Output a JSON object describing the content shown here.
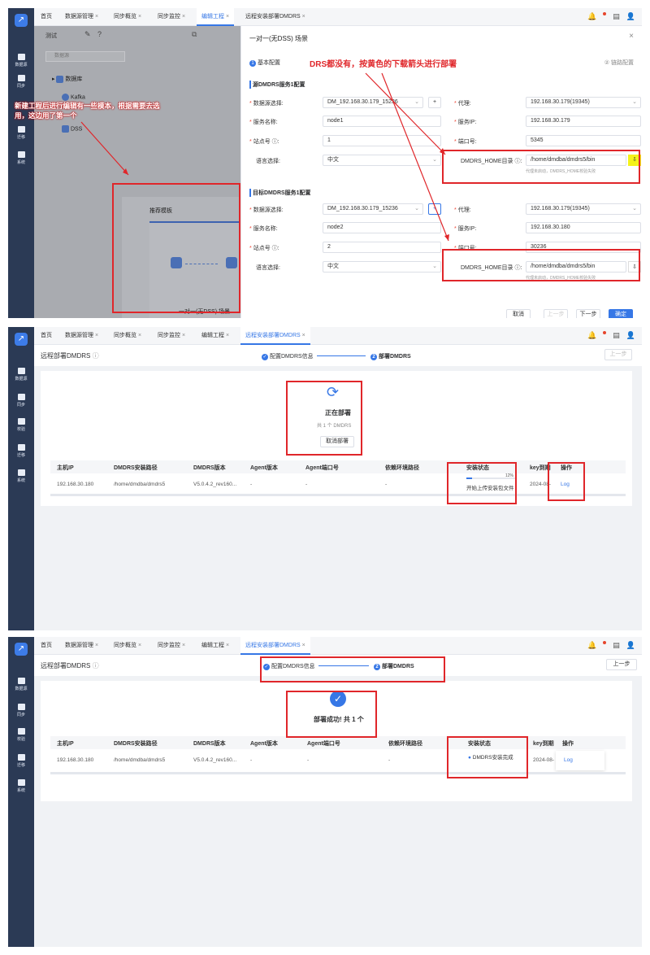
{
  "panel1": {
    "tabs": [
      "首页",
      "数据源管理",
      "同步概览",
      "同步监控",
      "编辑工程",
      "远程安装部署DMDRS"
    ],
    "nav": [
      "数据源",
      "同步",
      "迁移",
      "系统"
    ],
    "left": {
      "tool": "测试",
      "search_placeholder": "数据源",
      "tree": [
        "数据库",
        "Kafka",
        "DSS"
      ]
    },
    "tmpl_title": "推荐模板",
    "tmpl_name": "一对一(无DSS) 场景",
    "dialog": {
      "title": "一对一(无DSS) 场景",
      "step1": "基本配置",
      "step2": "链路配置",
      "src_title": "源DMDRS服务1配置",
      "dst_title": "目标DMDRS服务1配置",
      "lbl_ds": "数据源选择:",
      "lbl_svc": "服务名称:",
      "lbl_site": "站点号 ⓘ:",
      "lbl_lang": "语言选择:",
      "lbl_proxy": "代理:",
      "lbl_ip": "服务IP:",
      "lbl_port": "端口号:",
      "lbl_home": "DMDRS_HOME目录 ⓘ:",
      "src": {
        "ds": "DM_192.168.30.179_15236",
        "svc": "node1",
        "site": "1",
        "lang": "中文",
        "proxy": "192.168.30.179(19345)",
        "ip": "192.168.30.179",
        "port": "5345",
        "home": "/home/dmdba/dmdrs5/bin",
        "hint": "代理未启动，DMDRS_HOME校验失败"
      },
      "dst": {
        "ds": "DM_192.168.30.179_15236",
        "svc": "node2",
        "site": "2",
        "lang": "中文",
        "proxy": "192.168.30.179(19345)",
        "ip": "192.168.30.180",
        "port": "30236",
        "home": "/home/dmdba/dmdrs5/bin",
        "hint": "代理未启动，DMDRS_HOME校验失败"
      },
      "btns": [
        "取消",
        "上一步",
        "下一步",
        "确定"
      ]
    },
    "ann_left": "新建工程后进行编辑有一些模本，根据需要去选用，这边用了第一个",
    "ann_top": "DRS都没有，按黄色的下载箭头进行部署"
  },
  "panel2": {
    "tabs": [
      "首页",
      "数据源管理",
      "同步概览",
      "同步监控",
      "编辑工程",
      "远程安装部署DMDRS"
    ],
    "nav": [
      "数据源",
      "同步",
      "校验",
      "迁移",
      "系统"
    ],
    "title": "远程部署DMDRS",
    "step1": "配置DMDRS信息",
    "step2": "部署DMDRS",
    "prev": "上一步",
    "status": "正在部署",
    "count": "共 1 个 DMDRS",
    "cancel": "取消部署",
    "cols": [
      "主机IP",
      "DMDRS安装路径",
      "DMDRS版本",
      "Agent版本",
      "Agent端口号",
      "依赖环境路径",
      "安装状态",
      "key到期",
      "操作"
    ],
    "row": [
      "192.168.30.180",
      "/home/dmdba/dmdrs5",
      "V5.0.4.2_rev160...",
      "-",
      "-",
      "-",
      "开始上传安装包文件",
      "2024-08-",
      "Log"
    ],
    "pct": "12%"
  },
  "panel3": {
    "tabs": [
      "首页",
      "数据源管理",
      "同步概览",
      "同步监控",
      "编辑工程",
      "远程安装部署DMDRS"
    ],
    "nav": [
      "数据源",
      "同步",
      "校验",
      "迁移",
      "系统"
    ],
    "title": "远程部署DMDRS",
    "step1": "配置DMDRS信息",
    "step2": "部署DMDRS",
    "prev": "上一步",
    "status": "部署成功! 共 1 个",
    "cols": [
      "主机IP",
      "DMDRS安装路径",
      "DMDRS版本",
      "Agent版本",
      "Agent端口号",
      "依赖环境路径",
      "安装状态",
      "key到期",
      "操作"
    ],
    "row": [
      "192.168.30.180",
      "/home/dmdba/dmdrs5",
      "V5.0.4.2_rev160...",
      "-",
      "-",
      "-",
      "DMDRS安装完成",
      "2024-08-",
      "Log"
    ]
  }
}
